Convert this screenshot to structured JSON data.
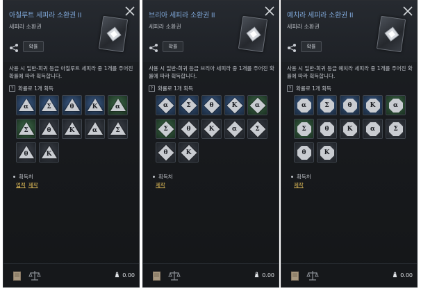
{
  "panels": [
    {
      "title": "아칠루트 세피라 소환권 II",
      "subtitle": "세피라 소환권",
      "probability_button": "확률",
      "description": "사용 시 일반-희귀 등급 아칠루트 세피라 중 1개를 주어진 확률에 따라 획득합니다.",
      "random_label": "확률로 1개 획득",
      "gem_shape": "triangle",
      "slots": [
        {
          "glyph": "α",
          "tone": "blue"
        },
        {
          "glyph": "Σ",
          "tone": "blue"
        },
        {
          "glyph": "θ",
          "tone": "blue"
        },
        {
          "glyph": "Κ",
          "tone": "blue"
        },
        {
          "glyph": "α",
          "tone": "green"
        },
        {
          "glyph": "Σ",
          "tone": "green"
        },
        {
          "glyph": "θ",
          "tone": "grey"
        },
        {
          "glyph": "Κ",
          "tone": "grey"
        },
        {
          "glyph": "α",
          "tone": "grey"
        },
        {
          "glyph": "Σ",
          "tone": "grey"
        },
        {
          "glyph": "θ",
          "tone": "grey"
        },
        {
          "glyph": "Κ",
          "tone": "grey"
        }
      ],
      "source_label": "획득처",
      "source_links": [
        "업적",
        "제작"
      ],
      "weight": "0.00"
    },
    {
      "title": "브리아 세피라 소환권 II",
      "subtitle": "세피라 소환권",
      "probability_button": "확률",
      "description": "사용 시 일반-희귀 등급 브리아 세피라 중 1개를 주어진 확률에 따라 획득합니다.",
      "random_label": "확률로 1개 획득",
      "gem_shape": "diamond",
      "slots": [
        {
          "glyph": "α",
          "tone": "blue"
        },
        {
          "glyph": "Σ",
          "tone": "blue"
        },
        {
          "glyph": "θ",
          "tone": "blue"
        },
        {
          "glyph": "Κ",
          "tone": "blue"
        },
        {
          "glyph": "α",
          "tone": "green"
        },
        {
          "glyph": "Σ",
          "tone": "green"
        },
        {
          "glyph": "θ",
          "tone": "grey"
        },
        {
          "glyph": "Κ",
          "tone": "grey"
        },
        {
          "glyph": "α",
          "tone": "grey"
        },
        {
          "glyph": "Σ",
          "tone": "grey"
        },
        {
          "glyph": "θ",
          "tone": "grey"
        },
        {
          "glyph": "Κ",
          "tone": "grey"
        }
      ],
      "source_label": "획득처",
      "source_links": [
        "제작"
      ],
      "weight": "0.00"
    },
    {
      "title": "예치라 세피라 소환권 II",
      "subtitle": "세피라 소환권",
      "probability_button": "확률",
      "description": "사용 시 일반-희귀 등급 예치라 세피라 중 1개를 주어진 확률에 따라 획득합니다.",
      "random_label": "확률로 1개 획득",
      "gem_shape": "octagon",
      "slots": [
        {
          "glyph": "α",
          "tone": "blue"
        },
        {
          "glyph": "Σ",
          "tone": "blue"
        },
        {
          "glyph": "θ",
          "tone": "blue"
        },
        {
          "glyph": "Κ",
          "tone": "blue"
        },
        {
          "glyph": "α",
          "tone": "green"
        },
        {
          "glyph": "Σ",
          "tone": "green"
        },
        {
          "glyph": "θ",
          "tone": "grey"
        },
        {
          "glyph": "Κ",
          "tone": "grey"
        },
        {
          "glyph": "α",
          "tone": "grey"
        },
        {
          "glyph": "Σ",
          "tone": "grey"
        },
        {
          "glyph": "θ",
          "tone": "grey"
        },
        {
          "glyph": "Κ",
          "tone": "grey"
        }
      ],
      "source_label": "획득처",
      "source_links": [
        "제작"
      ],
      "weight": "0.00"
    }
  ],
  "colors": {
    "title": "#7fa7d8",
    "link": "#e6c15a",
    "slot_blue": "#2d4a70",
    "slot_green": "#2f5238",
    "slot_grey": "#2e3238"
  },
  "icons": {
    "close": "close-icon",
    "share": "share-icon",
    "question": "question-icon",
    "book": "book-icon",
    "scale": "scale-icon",
    "weight": "weight-icon"
  }
}
